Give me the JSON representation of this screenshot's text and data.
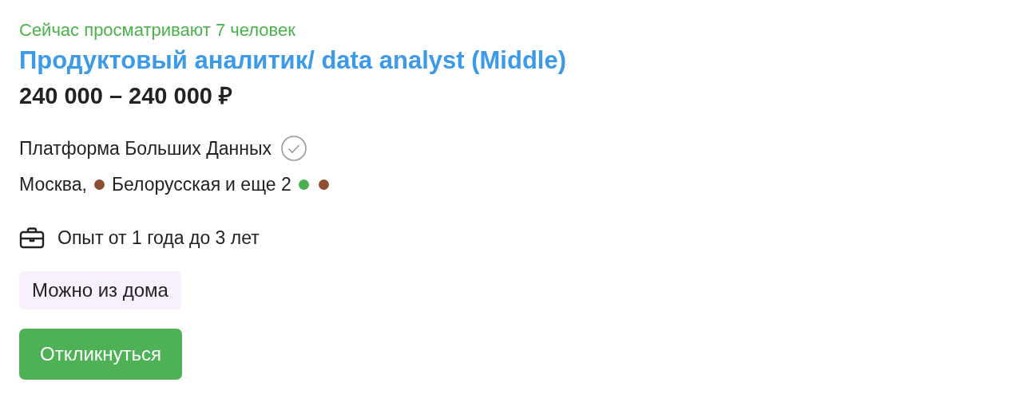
{
  "viewers": "Сейчас просматривают 7 человек",
  "title": "Продуктовый аналитик/ data analyst (Middle)",
  "salary": "240 000 – 240 000 ₽",
  "company": {
    "name": "Платформа Больших Данных",
    "verified": true
  },
  "location": {
    "city": "Москва,",
    "station": {
      "name": "Белорусская",
      "color": "#8f4e33"
    },
    "more": "и еще 2",
    "more_stations": [
      {
        "color": "#4caf50"
      },
      {
        "color": "#8f4e33"
      }
    ]
  },
  "experience": "Опыт от 1 года до 3 лет",
  "tags": [
    "Можно из дома"
  ],
  "apply_button": "Откликнуться"
}
